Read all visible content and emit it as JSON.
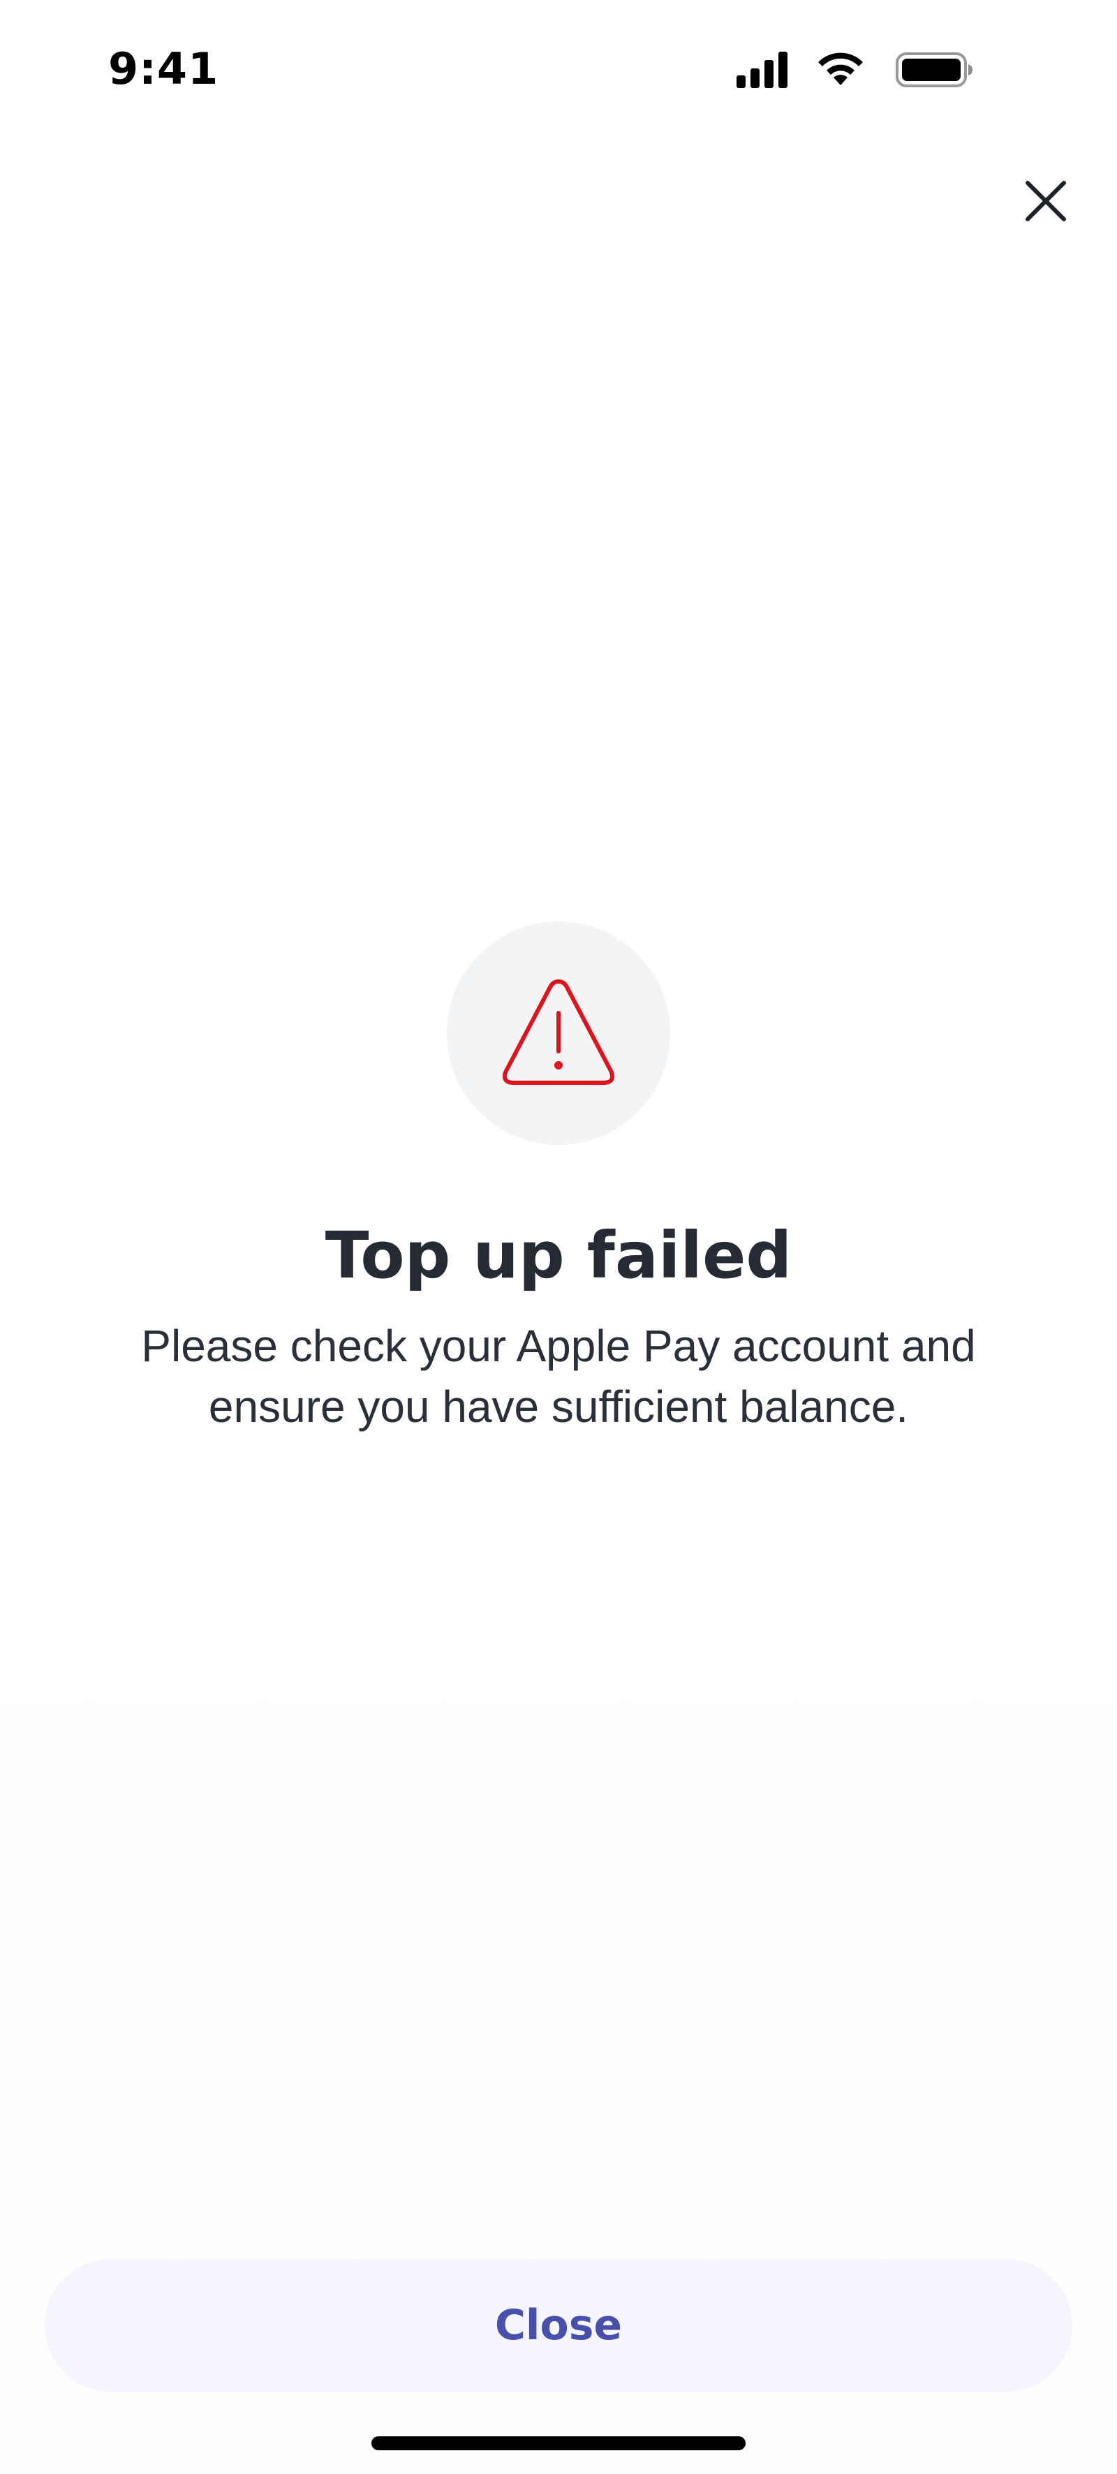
{
  "status_bar": {
    "time": "9:41",
    "icons": [
      "cellular-signal-icon",
      "wifi-icon",
      "battery-icon"
    ]
  },
  "header": {
    "close_icon": "close-icon"
  },
  "alert": {
    "icon": "warning-triangle-icon",
    "icon_color": "#e0121b",
    "circle_color": "#f3f4f6",
    "title": "Top up failed",
    "message_line1": "Please check your Apple Pay account and",
    "message_line2": "ensure you have sufficient balance."
  },
  "footer": {
    "close_label": "Close",
    "button_bg": "#f4f5fd",
    "button_text_color": "#4750ad"
  }
}
